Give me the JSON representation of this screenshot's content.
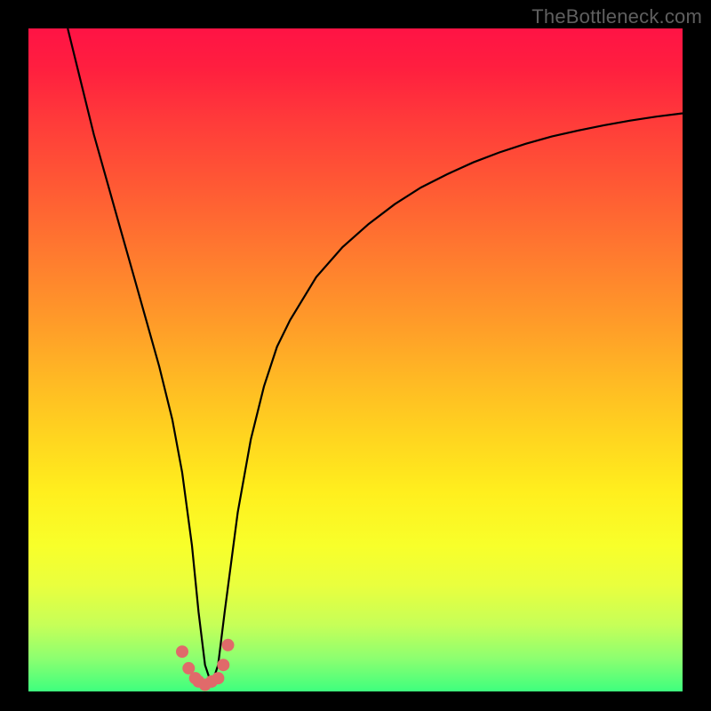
{
  "watermark": "TheBottleneck.com",
  "chart_data": {
    "type": "line",
    "title": "",
    "xlabel": "",
    "ylabel": "",
    "xlim": [
      0,
      100
    ],
    "ylim": [
      0,
      100
    ],
    "grid": false,
    "legend": false,
    "annotations": [],
    "series": [
      {
        "name": "curve",
        "color": "#000000",
        "x": [
          6,
          8,
          10,
          12,
          14,
          16,
          18,
          20,
          22,
          23.5,
          25,
          26,
          27,
          28,
          29,
          30,
          32,
          34,
          36,
          38,
          40,
          44,
          48,
          52,
          56,
          60,
          64,
          68,
          72,
          76,
          80,
          84,
          88,
          92,
          96,
          100
        ],
        "y": [
          100,
          92,
          84,
          77,
          70,
          63,
          56,
          49,
          41,
          33,
          22,
          12,
          4,
          1,
          4,
          12,
          27,
          38,
          46,
          52,
          56,
          62.5,
          67,
          70.5,
          73.5,
          76,
          78,
          79.8,
          81.3,
          82.6,
          83.7,
          84.6,
          85.4,
          86.1,
          86.7,
          87.2
        ]
      },
      {
        "name": "bottom-markers",
        "color": "#e06a6a",
        "type": "scatter",
        "x": [
          23.5,
          24.5,
          25.5,
          26,
          27,
          28,
          29,
          29.8,
          30.5
        ],
        "y": [
          6,
          3.5,
          2,
          1.5,
          1,
          1.5,
          2,
          4,
          7
        ]
      }
    ]
  }
}
